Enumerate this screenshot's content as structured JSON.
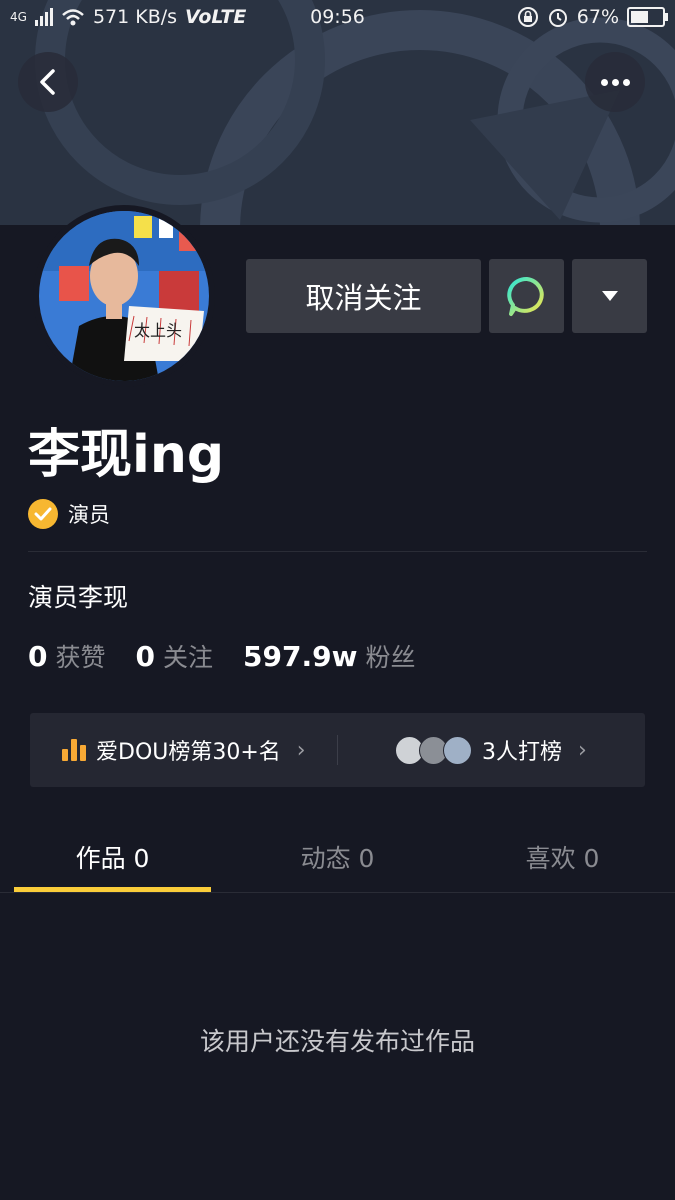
{
  "status_bar": {
    "network": "4G",
    "speed": "571 KB/s",
    "volte": "VoLTE",
    "time": "09:56",
    "battery": "67%",
    "battery_level": 0.67
  },
  "profile": {
    "follow_button_label": "取消关注",
    "name": "李现ing",
    "verified_label": "演员",
    "bio": "演员李现",
    "stats": [
      {
        "value": "0",
        "label": "获赞"
      },
      {
        "value": "0",
        "label": "关注"
      },
      {
        "value": "597.9w",
        "label": "粉丝"
      }
    ]
  },
  "rank": {
    "left_label": "爱DOU榜第30+名",
    "right_label": "3人打榜",
    "chevron": "›"
  },
  "tabs": [
    {
      "label": "作品 0"
    },
    {
      "label": "动态 0"
    },
    {
      "label": "喜欢 0"
    }
  ],
  "empty_message": "该用户还没有发布过作品",
  "colors": {
    "background": "#161823",
    "accent_yellow": "#facd3a",
    "verify_badge": "#f7b731",
    "chat_icon": "#33e0b0"
  }
}
